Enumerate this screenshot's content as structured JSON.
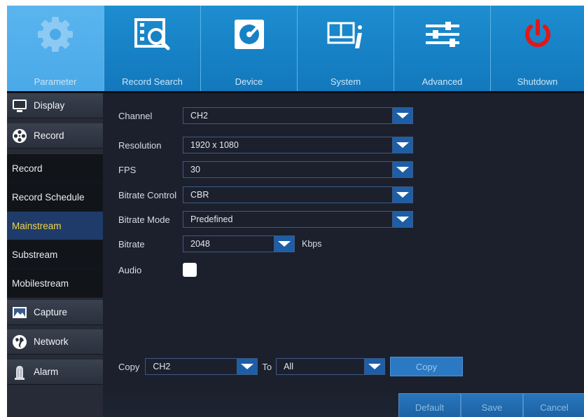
{
  "topmenu": {
    "tabs": [
      {
        "label": "Parameter",
        "icon": "gear-icon"
      },
      {
        "label": "Record Search",
        "icon": "film-search-icon"
      },
      {
        "label": "Device",
        "icon": "hard-disk-icon"
      },
      {
        "label": "System",
        "icon": "system-info-icon"
      },
      {
        "label": "Advanced",
        "icon": "sliders-icon"
      },
      {
        "label": "Shutdown",
        "icon": "power-icon"
      }
    ],
    "active": "Parameter",
    "colors": {
      "tab": "#1781c5",
      "active_tab": "#4aa9e8",
      "power": "#e01818"
    }
  },
  "sidebar": {
    "items": [
      {
        "label": "Display",
        "type": "category",
        "icon": "monitor-icon"
      },
      {
        "label": "Record",
        "type": "category",
        "icon": "film-reel-icon"
      },
      {
        "label": "Record",
        "type": "sub"
      },
      {
        "label": "Record Schedule",
        "type": "sub"
      },
      {
        "label": "Mainstream",
        "type": "sub",
        "active": true
      },
      {
        "label": "Substream",
        "type": "sub"
      },
      {
        "label": "Mobilestream",
        "type": "sub"
      },
      {
        "label": "Capture",
        "type": "category",
        "icon": "picture-icon"
      },
      {
        "label": "Network",
        "type": "category",
        "icon": "globe-icon"
      },
      {
        "label": "Alarm",
        "type": "category",
        "icon": "alarm-icon"
      }
    ],
    "active_color": "#f2d645"
  },
  "form": {
    "channel": {
      "label": "Channel",
      "value": "CH2"
    },
    "resolution": {
      "label": "Resolution",
      "value": "1920 x 1080"
    },
    "fps": {
      "label": "FPS",
      "value": "30"
    },
    "bitrate_control": {
      "label": "Bitrate Control",
      "value": "CBR"
    },
    "bitrate_mode": {
      "label": "Bitrate Mode",
      "value": "Predefined"
    },
    "bitrate": {
      "label": "Bitrate",
      "value": "2048",
      "unit": "Kbps"
    },
    "audio": {
      "label": "Audio",
      "checked": false
    }
  },
  "copy": {
    "label": "Copy",
    "from_value": "CH2",
    "to_label": "To",
    "to_value": "All",
    "button_label": "Copy"
  },
  "buttons": {
    "default": "Default",
    "save": "Save",
    "cancel": "Cancel"
  }
}
